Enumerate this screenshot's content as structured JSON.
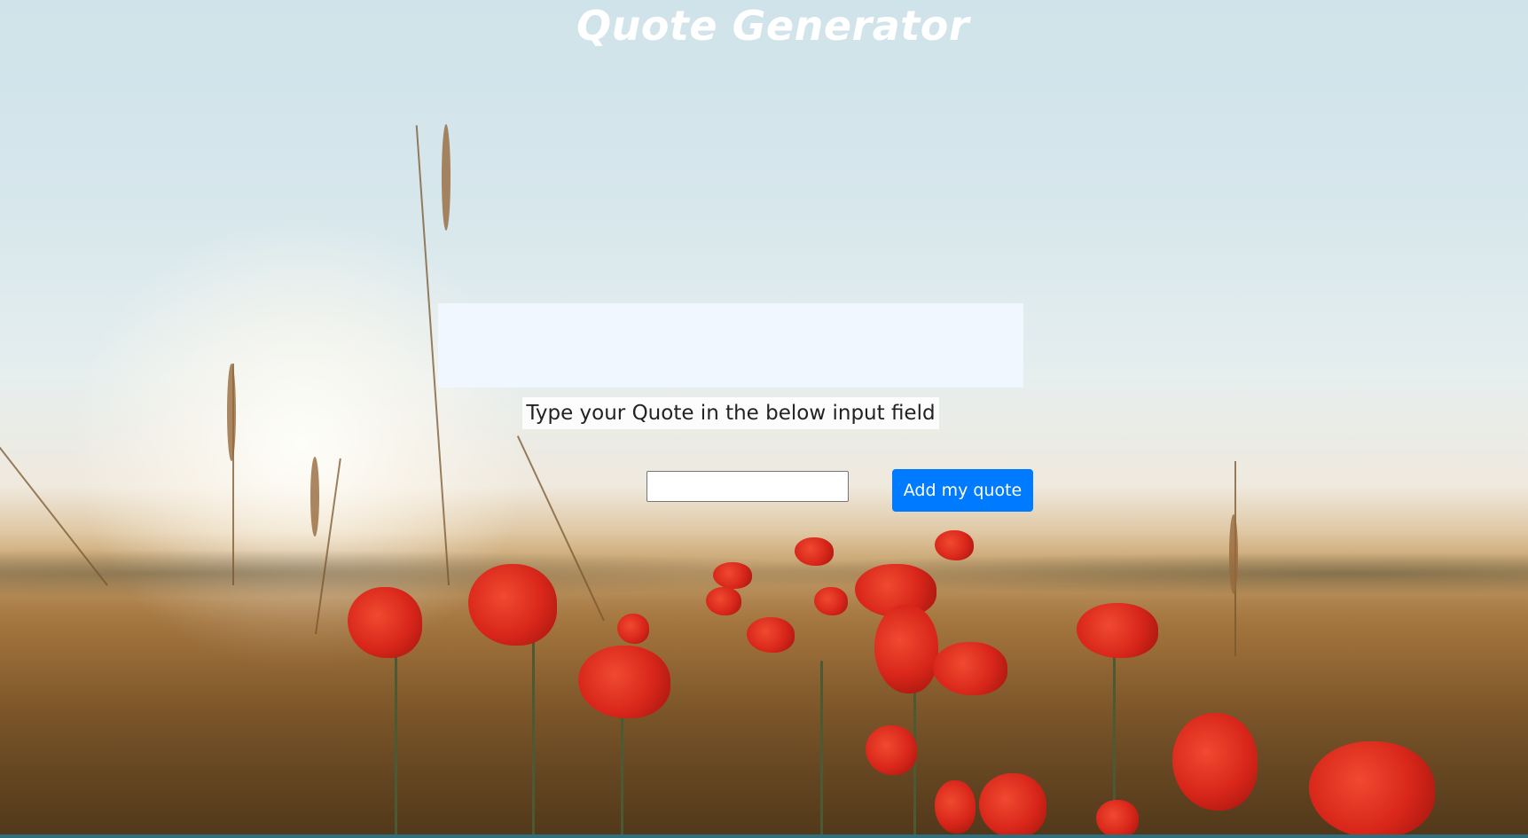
{
  "header": {
    "title": "Quote Generator"
  },
  "quote_display": {
    "text": ""
  },
  "form": {
    "instruction": "Type your Quote in the below input field",
    "input_value": "",
    "input_placeholder": "",
    "add_button_label": "Add my quote"
  },
  "colors": {
    "button": "#007bff",
    "quote_box": "#f0f7ff",
    "title": "#ffffff"
  },
  "background": {
    "icon": "poppy-field-photo"
  }
}
